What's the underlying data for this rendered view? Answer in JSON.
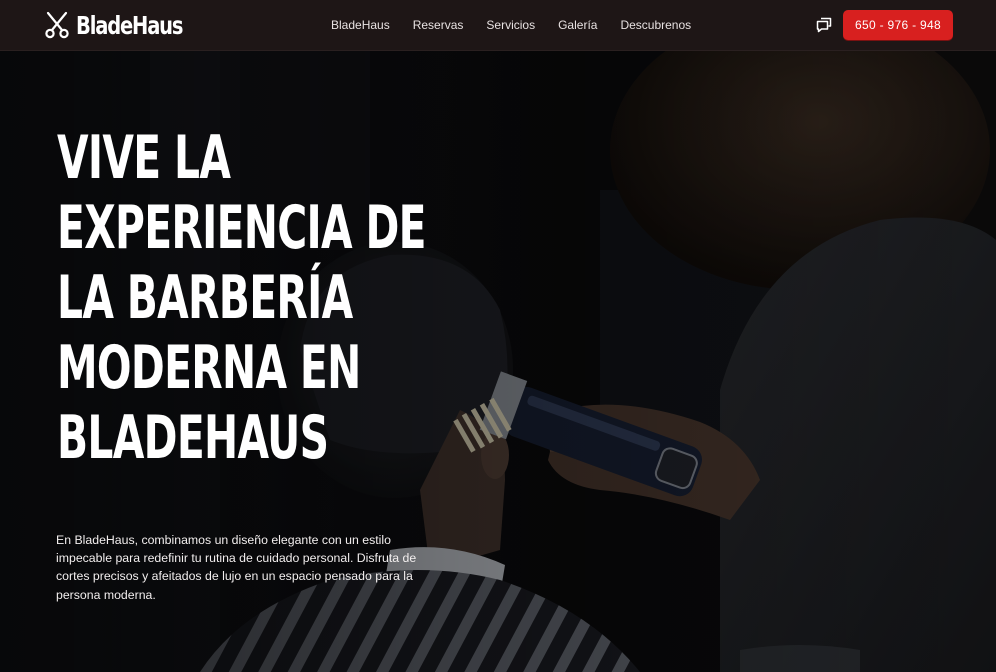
{
  "brand": {
    "name": "BladeHaus",
    "logo_icon": "scissors-icon"
  },
  "nav": {
    "items": [
      {
        "label": "BladeHaus"
      },
      {
        "label": "Reservas"
      },
      {
        "label": "Servicios"
      },
      {
        "label": "Galería"
      },
      {
        "label": "Descubrenos"
      }
    ]
  },
  "header_actions": {
    "chat_icon": "chat-icon",
    "phone_label": "650 - 976 - 948"
  },
  "hero": {
    "headline_lines": [
      "Vive la",
      "experiencia de",
      "la barbería",
      "moderna en",
      "BladeHaus"
    ],
    "description": "En BladeHaus, combinamos un diseño elegante con un estilo impecable para redefinir tu rutina de cuidado personal. Disfruta de cortes precisos y afeitados de lujo en un espacio pensado para la persona moderna."
  },
  "colors": {
    "accent": "#d8201f",
    "header_bg": "#1e1616",
    "text": "#ffffff"
  }
}
